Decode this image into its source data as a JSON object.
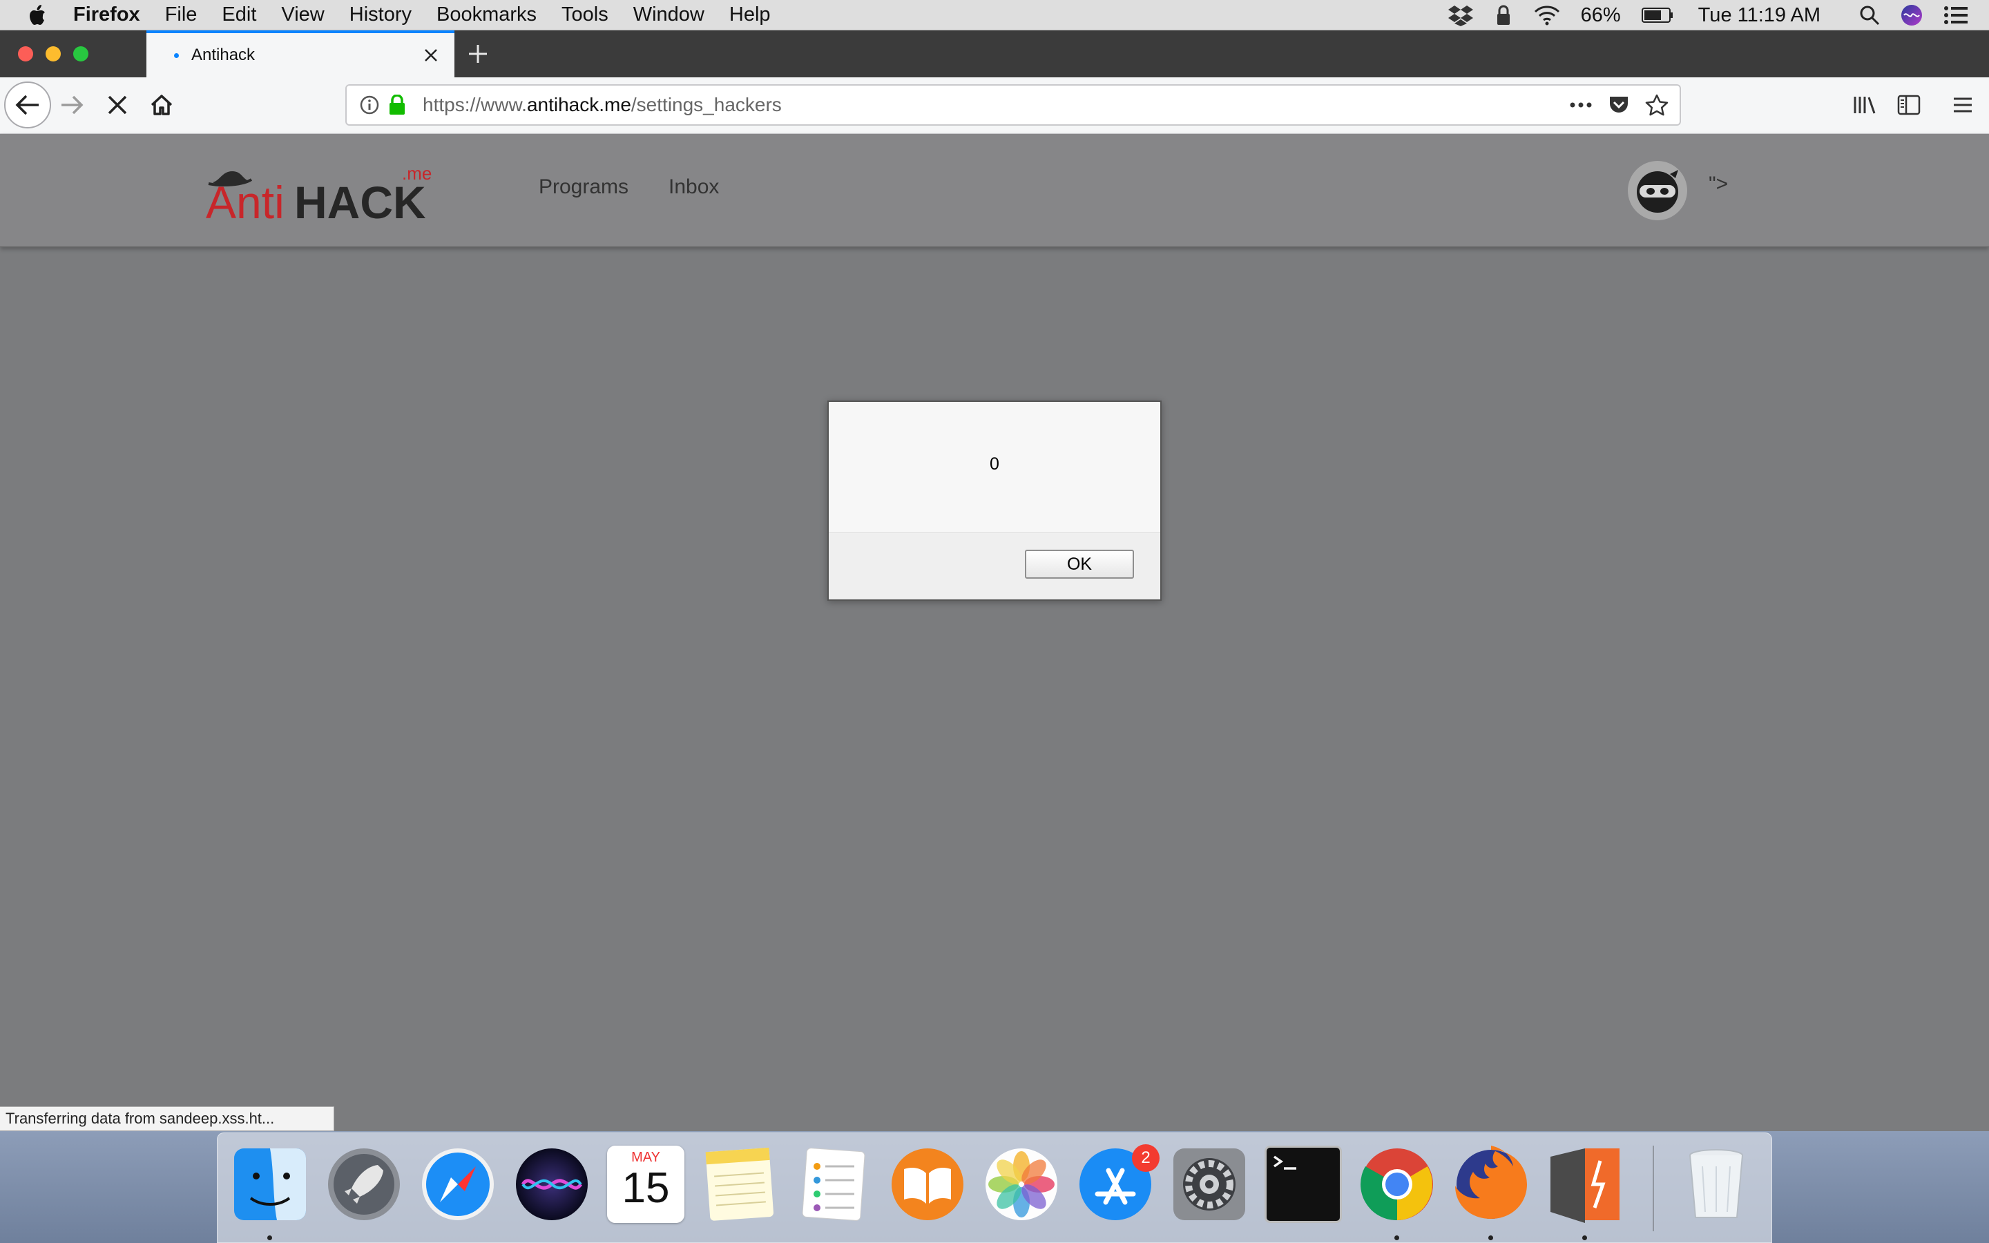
{
  "menubar": {
    "app_name": "Firefox",
    "items": [
      "File",
      "Edit",
      "View",
      "History",
      "Bookmarks",
      "Tools",
      "Window",
      "Help"
    ],
    "battery": "66%",
    "clock": "Tue 11:19 AM"
  },
  "browser": {
    "tab_title": "Antihack",
    "url_prefix": "https://www.",
    "url_host": "antihack.me",
    "url_path": "/settings_hackers",
    "status_text": "Transferring data from sandeep.xss.ht..."
  },
  "site": {
    "logo_text_main": "AntiHACK",
    "logo_text_suffix": ".me",
    "nav": [
      "Programs",
      "Inbox"
    ],
    "user_name": "\">"
  },
  "dialog": {
    "message": "0",
    "ok_label": "OK"
  },
  "dock": {
    "calendar_month": "MAY",
    "calendar_day": "15",
    "app_store_badge": "2"
  },
  "colors": {
    "accent": "#0a84ff",
    "logo_red": "#c8262a",
    "badge_red": "#f33b30"
  }
}
